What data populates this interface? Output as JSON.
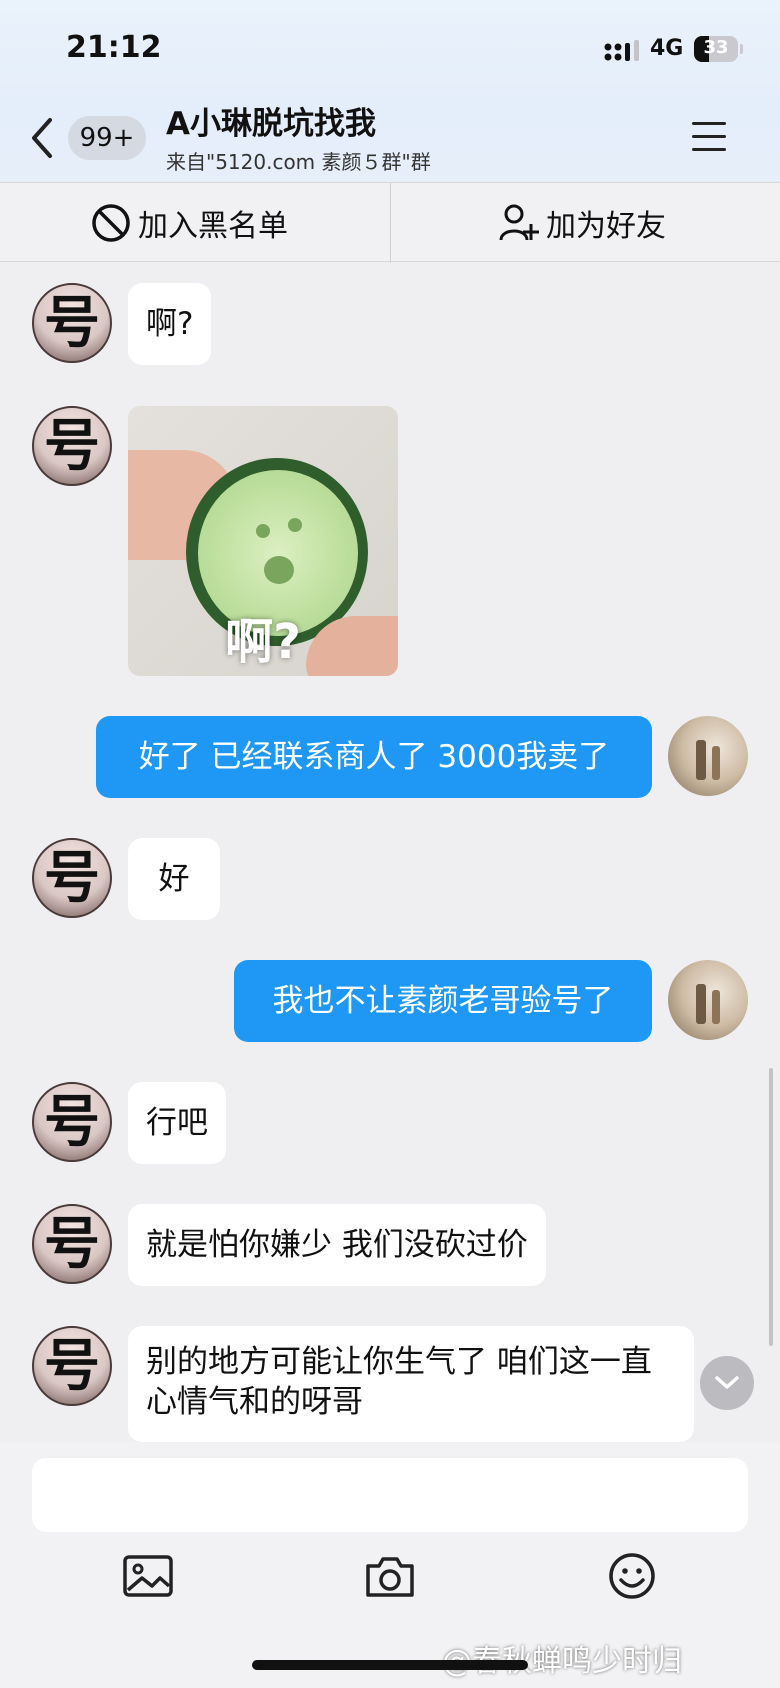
{
  "status_bar": {
    "time": "21:12",
    "network": "4G",
    "battery": "33",
    "battery_level": 0.33
  },
  "header": {
    "unread_badge": "99+",
    "title": "A小琳脱坑找我",
    "subtitle": "来自\"5120.com 素颜５群\"群"
  },
  "actions": {
    "blacklist_label": "加入黑名单",
    "add_friend_label": "加为好友"
  },
  "avatars": {
    "other_glyph": "号"
  },
  "messages": [
    {
      "side": "other",
      "type": "text",
      "text": "啊?"
    },
    {
      "side": "other",
      "type": "sticker",
      "caption": "啊?"
    },
    {
      "side": "me",
      "type": "text",
      "text": "好了 已经联系商人了 3000我卖了"
    },
    {
      "side": "other",
      "type": "text",
      "text": "好"
    },
    {
      "side": "me",
      "type": "text",
      "text": "我也不让素颜老哥验号了"
    },
    {
      "side": "other",
      "type": "text",
      "text": "行吧"
    },
    {
      "side": "other",
      "type": "text",
      "text": "就是怕你嫌少 我们没砍过价"
    },
    {
      "side": "other",
      "type": "text",
      "text": "别的地方可能让你生气了 咱们这一直心情气和的呀哥"
    }
  ],
  "composer": {
    "value": ""
  },
  "toolbar": {
    "icons": [
      "image-icon",
      "camera-icon",
      "emoji-icon"
    ]
  },
  "watermark": "@春秋蝉鸣少时归"
}
